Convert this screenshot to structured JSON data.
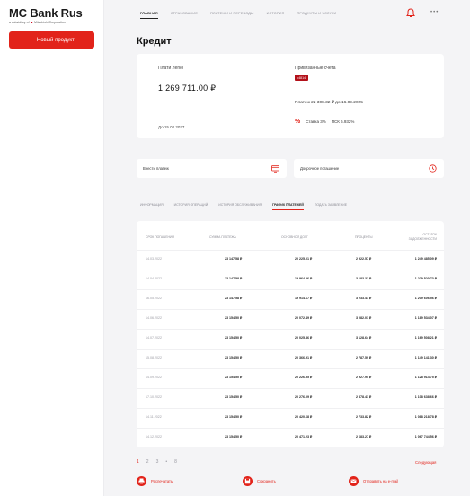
{
  "brand": {
    "title": "MC Bank Rus",
    "subtitle": "a subsidiary of",
    "subtitle_company": "Mitsubishi Corporation"
  },
  "sidebar": {
    "new_product_label": "Новый продукт"
  },
  "nav": {
    "items": [
      "ГЛАВНАЯ",
      "СТРАХОВАНИЕ",
      "ПЛАТЕЖИ И ПЕРЕВОДЫ",
      "ИСТОРИЯ",
      "ПРОДУКТЫ И УСЛУГИ"
    ],
    "active_index": 0
  },
  "page": {
    "title": "Кредит"
  },
  "loan": {
    "label": "Плати легко",
    "amount": "1 269 711.00 ₽",
    "until": "До 15.02.2027",
    "accounts_label": "Привязанные счета",
    "account_badge": "•4814",
    "payment": "Платеж 22 308.32 ₽ до 16.09.2025",
    "rate": "Ставка 3%",
    "psk": "ПСК 6.932%"
  },
  "actions": {
    "make_payment": "Внести платеж",
    "early_repayment": "Досрочное погашение"
  },
  "tabs": {
    "items": [
      "ИНФОРМАЦИЯ",
      "ИСТОРИЯ ОПЕРАЦИЙ",
      "ИСТОРИЯ ОБСЛУЖИВАНИЯ",
      "ГРАФИК ПЛАТЕЖЕЙ",
      "ПОДАТЬ ЗАЯВЛЕНИЕ"
    ],
    "active_index": 3
  },
  "schedule": {
    "headers": {
      "date": "СРОК ПОГАШЕНИЯ",
      "sum": "СУММА ПЛАТЕЖА",
      "principal": "ОСНОВНОЙ ДОЛГ",
      "interest": "ПРОЦЕНТЫ",
      "balance_1": "ОСТАТОК",
      "balance_2": "ЗАДОЛЖЕННОСТИ"
    },
    "rows": [
      {
        "date": "14.03.2022",
        "sum": "23 147.58 ₽",
        "principal": "20 225.01 ₽",
        "interest": "2 922.57 ₽",
        "balance": "1 249 485.09 ₽"
      },
      {
        "date": "14.04.2022",
        "sum": "23 147.58 ₽",
        "principal": "19 964.26 ₽",
        "interest": "3 183.32 ₽",
        "balance": "1 229 520.73 ₽"
      },
      {
        "date": "16.05.2022",
        "sum": "23 147.58 ₽",
        "principal": "19 914.17 ₽",
        "interest": "3 233.41 ₽",
        "balance": "1 209 606.56 ₽"
      },
      {
        "date": "14.06.2022",
        "sum": "23 154.50 ₽",
        "principal": "20 072.49 ₽",
        "interest": "3 082.01 ₽",
        "balance": "1 189 534.07 ₽"
      },
      {
        "date": "14.07.2022",
        "sum": "23 154.50 ₽",
        "principal": "20 025.86 ₽",
        "interest": "3 128.64 ₽",
        "balance": "1 169 508.21 ₽"
      },
      {
        "date": "15.08.2022",
        "sum": "23 154.50 ₽",
        "principal": "20 366.91 ₽",
        "interest": "2 787.59 ₽",
        "balance": "1 149 141.30 ₽"
      },
      {
        "date": "14.09.2022",
        "sum": "23 154.50 ₽",
        "principal": "20 226.55 ₽",
        "interest": "2 927.95 ₽",
        "balance": "1 128 914.75 ₽"
      },
      {
        "date": "17.10.2022",
        "sum": "23 154.50 ₽",
        "principal": "20 276.09 ₽",
        "interest": "2 878.41 ₽",
        "balance": "1 108 638.66 ₽"
      },
      {
        "date": "14.11.2022",
        "sum": "23 154.50 ₽",
        "principal": "20 420.68 ₽",
        "interest": "2 733.82 ₽",
        "balance": "1 088 218.78 ₽"
      },
      {
        "date": "14.12.2022",
        "sum": "23 154.50 ₽",
        "principal": "20 471.23 ₽",
        "interest": "2 683.27 ₽",
        "balance": "1 067 744.56 ₽"
      }
    ]
  },
  "pagination": {
    "pages": [
      "1",
      "2",
      "3",
      "•",
      "8"
    ],
    "current_index": 0,
    "next_label": "Следующая"
  },
  "footer": {
    "print": "Распечатать",
    "save": "Сохранить",
    "email": "Отправить на e-mail"
  },
  "colors": {
    "accent": "#e2231a",
    "badge": "#b3111a"
  }
}
